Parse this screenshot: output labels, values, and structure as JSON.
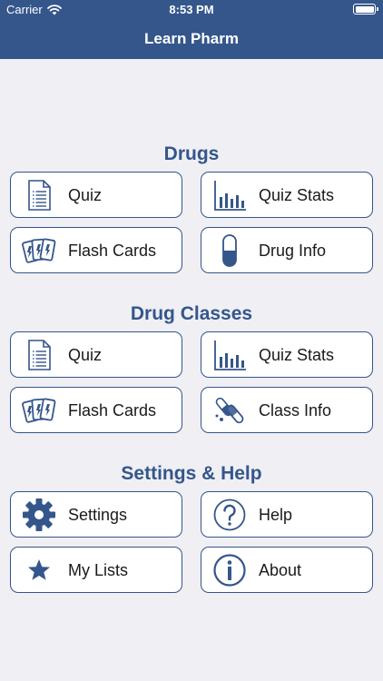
{
  "status_bar": {
    "carrier": "Carrier",
    "time": "8:53 PM"
  },
  "nav": {
    "title": "Learn Pharm"
  },
  "colors": {
    "accent": "#34568b",
    "background": "#efeff4"
  },
  "sections": {
    "drugs": {
      "title": "Drugs",
      "quiz": "Quiz",
      "quiz_stats": "Quiz Stats",
      "flash_cards": "Flash Cards",
      "drug_info": "Drug Info"
    },
    "drug_classes": {
      "title": "Drug Classes",
      "quiz": "Quiz",
      "quiz_stats": "Quiz Stats",
      "flash_cards": "Flash Cards",
      "class_info": "Class Info"
    },
    "settings_help": {
      "title": "Settings & Help",
      "settings": "Settings",
      "help": "Help",
      "my_lists": "My Lists",
      "about": "About"
    }
  },
  "icons": {
    "quiz": "document-list-icon",
    "quiz_stats": "bar-chart-icon",
    "flash_cards": "flash-cards-icon",
    "drug_info": "capsule-icon",
    "class_info": "pills-icon",
    "settings": "gear-icon",
    "help": "question-icon",
    "my_lists": "star-icon",
    "about": "info-icon"
  }
}
